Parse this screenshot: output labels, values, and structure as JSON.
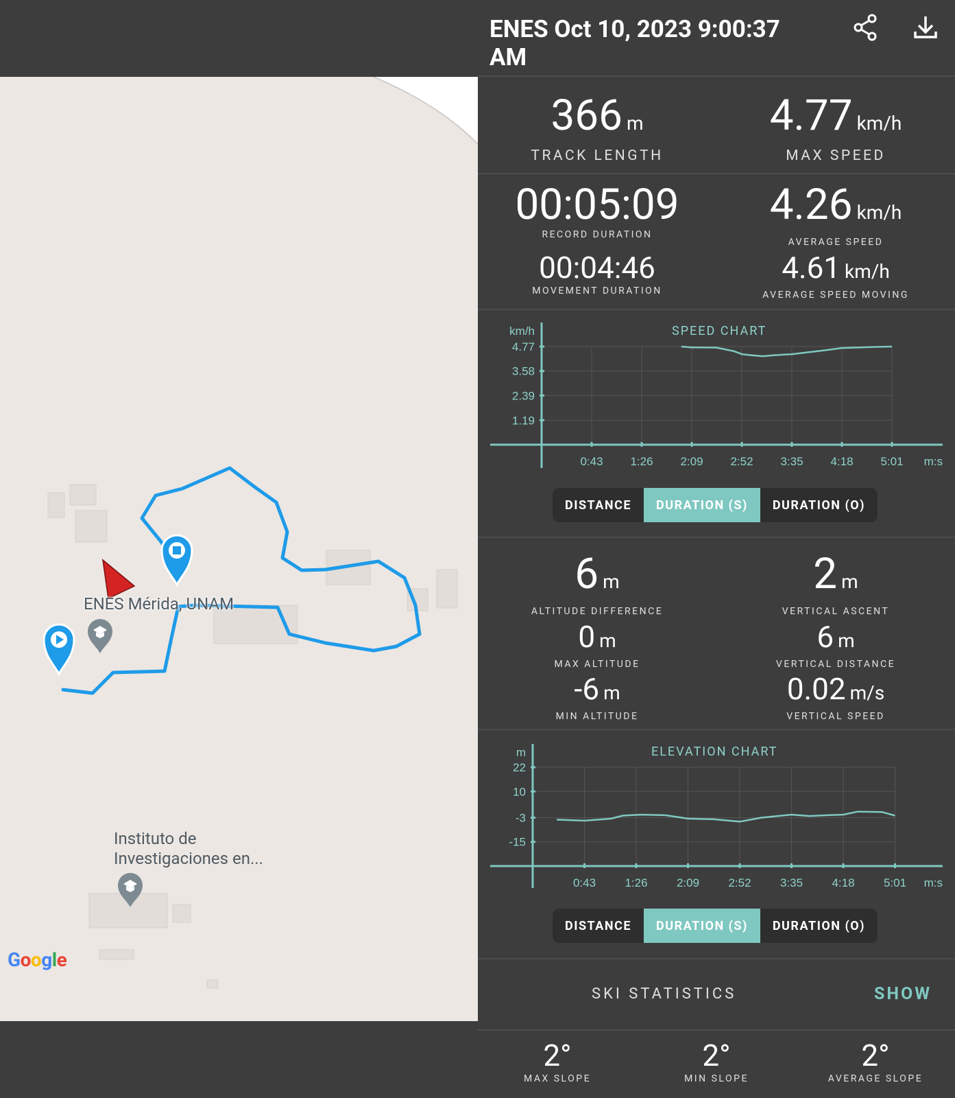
{
  "header": {
    "title": "ENES Oct 10, 2023 9:00:37 AM",
    "share_icon": "share-icon",
    "download_icon": "download-icon"
  },
  "map": {
    "place_label": "ENES Mérida, UNAM",
    "place2_label_line1": "Instituto de",
    "place2_label_line2": "Investigaciones en...",
    "logo": "Google",
    "colors": {
      "track": "#1e9be9",
      "pin": "#1e9be9",
      "arrow": "#d32323"
    }
  },
  "stats": {
    "track_length": {
      "value": "366",
      "unit": "m",
      "label": "TRACK LENGTH"
    },
    "max_speed": {
      "value": "4.77",
      "unit": "km/h",
      "label": "MAX SPEED"
    },
    "record_duration": {
      "value": "00:05:09",
      "label": "RECORD DURATION"
    },
    "average_speed": {
      "value": "4.26",
      "unit": "km/h",
      "label": "AVERAGE SPEED"
    },
    "movement_duration": {
      "value": "00:04:46",
      "label": "MOVEMENT DURATION"
    },
    "average_speed_moving": {
      "value": "4.61",
      "unit": "km/h",
      "label": "AVERAGE SPEED MOVING"
    },
    "altitude_difference": {
      "value": "6",
      "unit": "m",
      "label": "ALTITUDE DIFFERENCE"
    },
    "vertical_ascent": {
      "value": "2",
      "unit": "m",
      "label": "VERTICAL ASCENT"
    },
    "max_altitude": {
      "value": "0",
      "unit": "m",
      "label": "MAX ALTITUDE"
    },
    "vertical_distance": {
      "value": "6",
      "unit": "m",
      "label": "VERTICAL DISTANCE"
    },
    "min_altitude": {
      "value": "-6",
      "unit": "m",
      "label": "MIN ALTITUDE"
    },
    "vertical_speed": {
      "value": "0.02",
      "unit": "m/s",
      "label": "VERTICAL SPEED"
    }
  },
  "speed_chart": {
    "title": "SPEED CHART",
    "mode_buttons": [
      "DISTANCE",
      "DURATION (S)",
      "DURATION (O)"
    ],
    "active_mode": "DURATION (S)"
  },
  "elevation_chart": {
    "title": "ELEVATION CHART",
    "mode_buttons": [
      "DISTANCE",
      "DURATION (S)",
      "DURATION (O)"
    ],
    "active_mode": "DURATION (S)"
  },
  "ski": {
    "label": "SKI STATISTICS",
    "show_label": "SHOW"
  },
  "slopes": {
    "max": {
      "value": "2°",
      "label": "MAX SLOPE"
    },
    "min": {
      "value": "2°",
      "label": "MIN SLOPE"
    },
    "avg": {
      "value": "2°",
      "label": "AVERAGE SLOPE"
    }
  },
  "chart_data": [
    {
      "type": "line",
      "title": "SPEED CHART",
      "ylabel": "km/h",
      "xlabel": "m:s",
      "x_ticks": [
        "0:43",
        "1:26",
        "2:09",
        "2:52",
        "3:35",
        "4:18",
        "5:01"
      ],
      "y_ticks": [
        "1.19",
        "2.39",
        "3.58",
        "4.77"
      ],
      "ylim": [
        0,
        4.77
      ],
      "series": [
        {
          "x": [
            "2:00",
            "2:09",
            "2:30",
            "2:45",
            "2:52",
            "3:00",
            "3:10",
            "3:20",
            "3:35",
            "3:50",
            "4:05",
            "4:18",
            "4:30",
            "4:45",
            "5:01"
          ],
          "values": [
            4.77,
            4.73,
            4.72,
            4.55,
            4.4,
            4.35,
            4.3,
            4.35,
            4.4,
            4.5,
            4.6,
            4.7,
            4.72,
            4.75,
            4.77
          ]
        }
      ]
    },
    {
      "type": "line",
      "title": "ELEVATION CHART",
      "ylabel": "m",
      "xlabel": "m:s",
      "x_ticks": [
        "0:43",
        "1:26",
        "2:09",
        "2:52",
        "3:35",
        "4:18",
        "5:01"
      ],
      "y_ticks": [
        "-15",
        "-3",
        "10",
        "22"
      ],
      "ylim": [
        -27,
        22
      ],
      "series": [
        {
          "x": [
            "0:20",
            "0:43",
            "1:05",
            "1:15",
            "1:30",
            "1:50",
            "2:09",
            "2:30",
            "2:52",
            "3:10",
            "3:35",
            "3:50",
            "4:05",
            "4:18",
            "4:30",
            "4:50",
            "5:01"
          ],
          "values": [
            -4,
            -4.5,
            -3.5,
            -2,
            -1.5,
            -1.8,
            -3.5,
            -3.8,
            -5,
            -3,
            -1.5,
            -2.2,
            -1.8,
            -1.5,
            0,
            -0.2,
            -2
          ]
        }
      ]
    }
  ]
}
